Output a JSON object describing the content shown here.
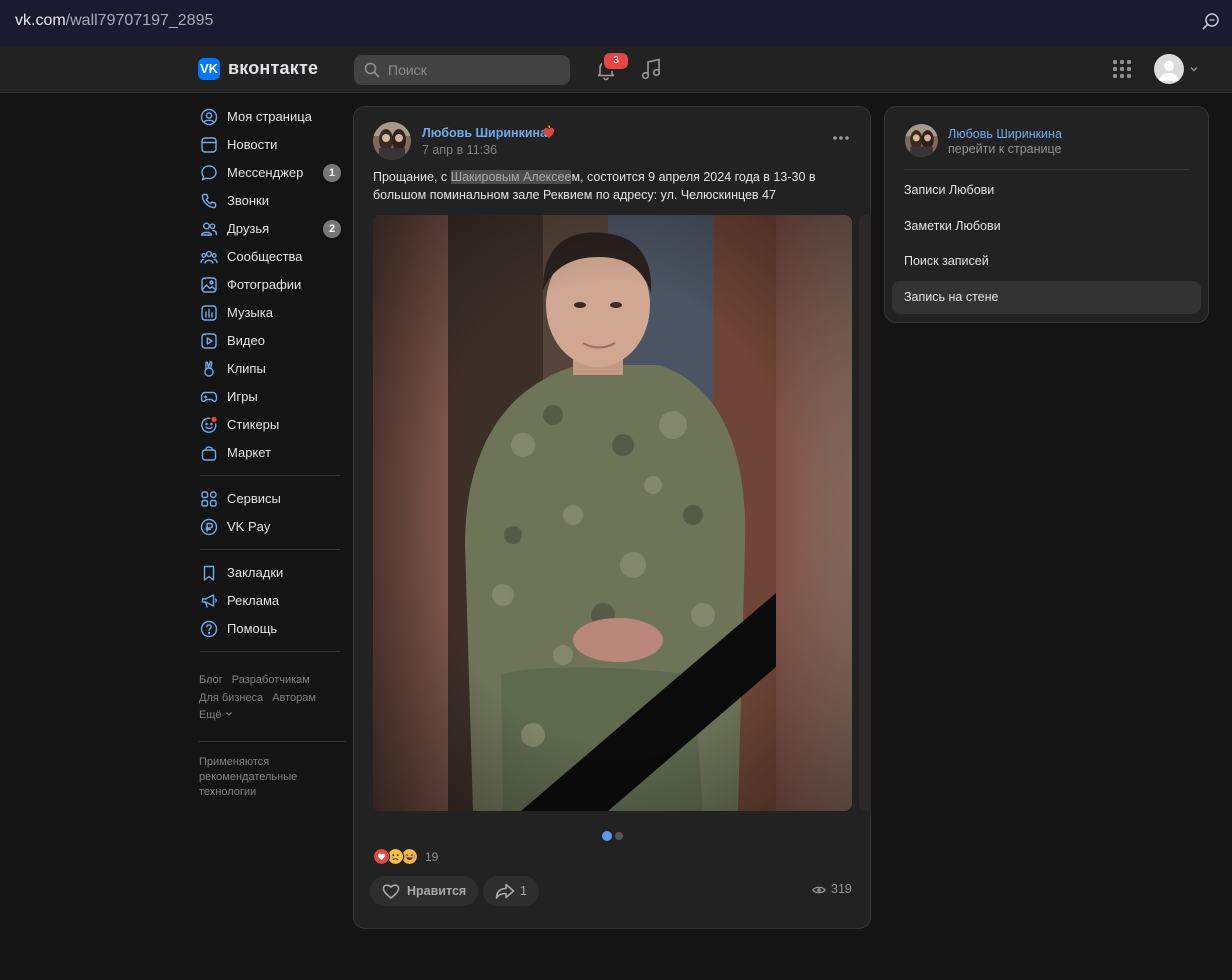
{
  "browser": {
    "url_host": "vk.com",
    "url_path": "/wall79707197_2895"
  },
  "header": {
    "logo_glyph": "VK",
    "brand": "вконтакте",
    "search_placeholder": "Поиск",
    "notifications_count": "3",
    "icons": [
      "bell-icon",
      "music-icon",
      "apps-grid-icon",
      "avatar",
      "chevron-down-icon"
    ]
  },
  "nav": {
    "main": [
      {
        "label": "Моя страница",
        "icon": "user-circle-icon"
      },
      {
        "label": "Новости",
        "icon": "news-icon"
      },
      {
        "label": "Мессенджер",
        "icon": "message-icon",
        "count": "1"
      },
      {
        "label": "Звонки",
        "icon": "phone-icon"
      },
      {
        "label": "Друзья",
        "icon": "friends-icon",
        "count": "2"
      },
      {
        "label": "Сообщества",
        "icon": "communities-icon"
      },
      {
        "label": "Фотографии",
        "icon": "photos-icon"
      },
      {
        "label": "Музыка",
        "icon": "music-icon"
      },
      {
        "label": "Видео",
        "icon": "video-icon"
      },
      {
        "label": "Клипы",
        "icon": "clips-icon"
      },
      {
        "label": "Игры",
        "icon": "games-icon"
      },
      {
        "label": "Стикеры",
        "icon": "stickers-icon"
      },
      {
        "label": "Маркет",
        "icon": "market-icon"
      }
    ],
    "services": [
      {
        "label": "Сервисы",
        "icon": "services-icon"
      },
      {
        "label": "VK Pay",
        "icon": "vkpay-icon"
      }
    ],
    "extra": [
      {
        "label": "Закладки",
        "icon": "bookmark-icon"
      },
      {
        "label": "Реклама",
        "icon": "ads-icon"
      },
      {
        "label": "Помощь",
        "icon": "help-icon"
      }
    ],
    "footer_links": [
      "Блог",
      "Разработчикам",
      "Для бизнеса",
      "Авторам",
      "Ещё"
    ],
    "footer_note": "Применяются рекомендательные технологии"
  },
  "post": {
    "author": "Любовь Ширинкина",
    "date": "7 апр в 11:36",
    "text_before": "Прощание, с ",
    "text_highlight": "Шакировым Алексее",
    "text_after": "м, состоится 9 апреля 2024 года в 13-30 в большом поминальном зале Реквием по адресу: ул. Челюскинцев 47",
    "photo_count": 2,
    "active_photo": 1,
    "reactions_count": "19",
    "like_label": "Нравится",
    "share_count": "1",
    "views": "319"
  },
  "side": {
    "name": "Любовь Ширинкина",
    "sub": "перейти к странице",
    "items": [
      {
        "label": "Записи Любови",
        "selected": false
      },
      {
        "label": "Заметки Любови",
        "selected": false
      },
      {
        "label": "Поиск записей",
        "selected": false
      },
      {
        "label": "Запись на стене",
        "selected": true
      }
    ]
  },
  "colors": {
    "accent": "#0077ff",
    "link": "#71aaeb",
    "badge": "#e64646",
    "dot_active": "#5a9be8"
  }
}
